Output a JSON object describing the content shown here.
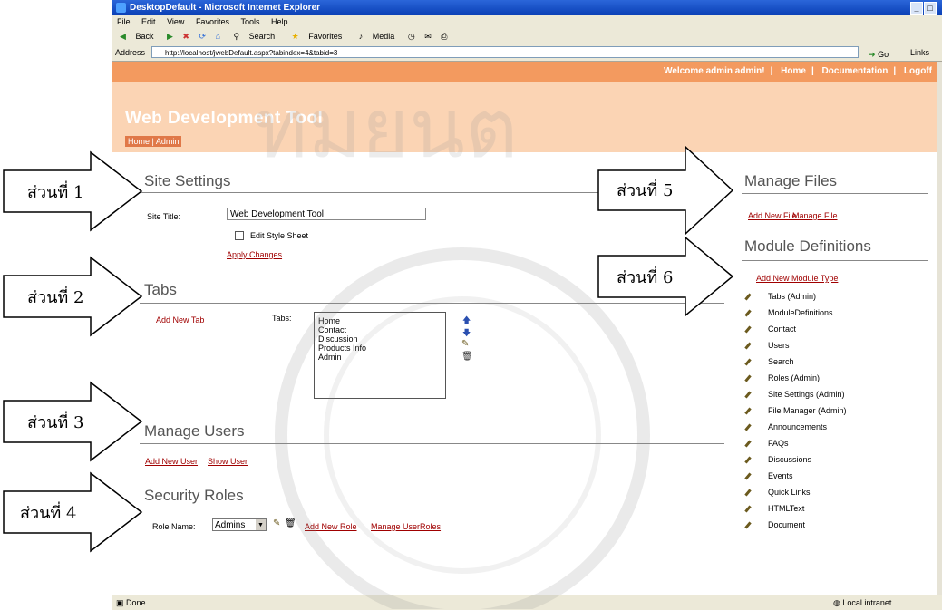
{
  "browser": {
    "title": "DesktopDefault - Microsoft Internet Explorer",
    "menu": [
      "File",
      "Edit",
      "View",
      "Favorites",
      "Tools",
      "Help"
    ],
    "toolbar": [
      "Back",
      "Search",
      "Favorites",
      "Media"
    ],
    "address_label": "Address",
    "address_value": "http://localhost/jwebDefault.aspx?tabindex=4&tabid=3",
    "go_label": "Go",
    "links_label": "Links",
    "status_left": "Done",
    "status_right": "Local intranet"
  },
  "portal": {
    "topbar": {
      "welcome": "Welcome admin admin!",
      "home": "Home",
      "documentation": "Documentation",
      "logoff": "Logoff"
    },
    "brand": "Web Development Tool",
    "breadcrumb": "Home | Admin"
  },
  "site_settings": {
    "title": "Site Settings",
    "site_title_label": "Site Title:",
    "site_title_value": "Web Development Tool",
    "edit_style_label": "Edit Style Sheet",
    "apply_label": "Apply Changes"
  },
  "tabs": {
    "title": "Tabs",
    "add_new": "Add New Tab",
    "tabs_label": "Tabs:",
    "items": [
      "Home",
      "Contact",
      "Discussion",
      "Products Info",
      "Admin"
    ]
  },
  "manage_users": {
    "title": "Manage Users",
    "add_new": "Add New User",
    "show": "Show User"
  },
  "security_roles": {
    "title": "Security Roles",
    "role_label": "Role Name:",
    "role_value": "Admins",
    "add_new": "Add New Role",
    "manage": "Manage UserRoles"
  },
  "manage_files": {
    "title": "Manage Files",
    "add_new": "Add New File",
    "manage": "Manage File"
  },
  "module_definitions": {
    "title": "Module Definitions",
    "add_new": "Add New Module Type",
    "items": [
      "Tabs (Admin)",
      "ModuleDefinitions",
      "Contact",
      "Users",
      "Search",
      "Roles (Admin)",
      "Site Settings (Admin)",
      "File Manager (Admin)",
      "Announcements",
      "FAQs",
      "Discussions",
      "Events",
      "Quick Links",
      "HTMLText",
      "Document"
    ]
  },
  "callouts": [
    "ส่วนที่ 1",
    "ส่วนที่ 2",
    "ส่วนที่ 3",
    "ส่วนที่ 4",
    "ส่วนที่ 5",
    "ส่วนที่ 6"
  ],
  "watermark": "ทมยนต"
}
